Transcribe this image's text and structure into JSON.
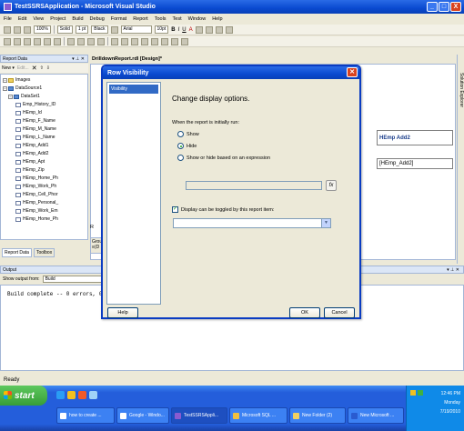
{
  "window": {
    "title": "TestSSRSApplication - Microsoft Visual Studio",
    "min": "_",
    "max": "□",
    "close": "X"
  },
  "menu": [
    "File",
    "Edit",
    "View",
    "Project",
    "Build",
    "Debug",
    "Format",
    "Report",
    "Tools",
    "Test",
    "Window",
    "Help"
  ],
  "toolbar": {
    "zoom": "100%",
    "line_style": "Solid",
    "line_width": "1 pt",
    "line_color": "Black",
    "font": "Arial",
    "font_size": "10pt",
    "bold": "B",
    "italic": "I",
    "underline": "U",
    "font_color": "A"
  },
  "report_data": {
    "title": "Report Data",
    "new_label": "New ▾",
    "edit_label": "Edit...",
    "tree": [
      {
        "label": "Images",
        "kind": "folder",
        "indent": 0
      },
      {
        "label": "DataSource1",
        "kind": "ds",
        "indent": 0
      },
      {
        "label": "DataSet1",
        "kind": "ds",
        "indent": 1
      },
      {
        "label": "Emp_History_ID",
        "kind": "field",
        "indent": 2
      },
      {
        "label": "HEmp_Id",
        "kind": "field",
        "indent": 2
      },
      {
        "label": "HEmp_F_Name",
        "kind": "field",
        "indent": 2
      },
      {
        "label": "HEmp_M_Name",
        "kind": "field",
        "indent": 2
      },
      {
        "label": "HEmp_L_Name",
        "kind": "field",
        "indent": 2
      },
      {
        "label": "HEmp_Add1",
        "kind": "field",
        "indent": 2
      },
      {
        "label": "HEmp_Add2",
        "kind": "field",
        "indent": 2
      },
      {
        "label": "HEmp_Apt",
        "kind": "field",
        "indent": 2
      },
      {
        "label": "HEmp_Zip",
        "kind": "field",
        "indent": 2
      },
      {
        "label": "HEmp_Home_Ph",
        "kind": "field",
        "indent": 2
      },
      {
        "label": "HEmp_Work_Ph",
        "kind": "field",
        "indent": 2
      },
      {
        "label": "HEmp_Cell_Phor",
        "kind": "field",
        "indent": 2
      },
      {
        "label": "HEmp_Personal_",
        "kind": "field",
        "indent": 2
      },
      {
        "label": "HEmp_Work_Em",
        "kind": "field",
        "indent": 2
      },
      {
        "label": "HEmp_Home_Ph",
        "kind": "field",
        "indent": 2
      }
    ],
    "tabs": [
      "Report Data",
      "Toolbox"
    ]
  },
  "designer": {
    "tab": "DrilldownReport.rdl [Design]*",
    "header_cell": "HEmp Add2",
    "data_cell": "[HEmp_Add2]",
    "grouping_label": "Grou",
    "grouping_sub": "≡(D",
    "row_label": "R"
  },
  "side_strip": "Solution Explorer",
  "output": {
    "title": "Output",
    "from_label": "Show output from:",
    "from_value": "Build",
    "text": "Build complete -- 0 errors, 0"
  },
  "status": "Ready",
  "dialog": {
    "title": "Row Visibility",
    "nav": [
      "Visibility"
    ],
    "heading": "Change display options.",
    "when_label": "When the report is initially run:",
    "opt_show": "Show",
    "opt_hide": "Hide",
    "opt_expr": "Show or hide based on an expression",
    "selected": "Hide",
    "toggle_checked": true,
    "toggle_label": "Display can be toggled by this report item:",
    "toggle_value": "",
    "fx": "fx",
    "help": "Help",
    "ok": "OK",
    "cancel": "Cancel"
  },
  "taskbar": {
    "start": "start",
    "tasks": [
      "how to create ...",
      "Google - Windo...",
      "TestSSRSAppli...",
      "Microsoft SQL ...",
      "New Folder (2)",
      "New Microsoft ..."
    ],
    "time": "12:46 PM",
    "day": "Monday",
    "date": "7/19/2010"
  },
  "colors": {
    "xp_blue": "#245edb",
    "title_blue": "#0a4ad0",
    "selection": "#316ac5",
    "close_red": "#d8431f",
    "start_green": "#379d37"
  }
}
